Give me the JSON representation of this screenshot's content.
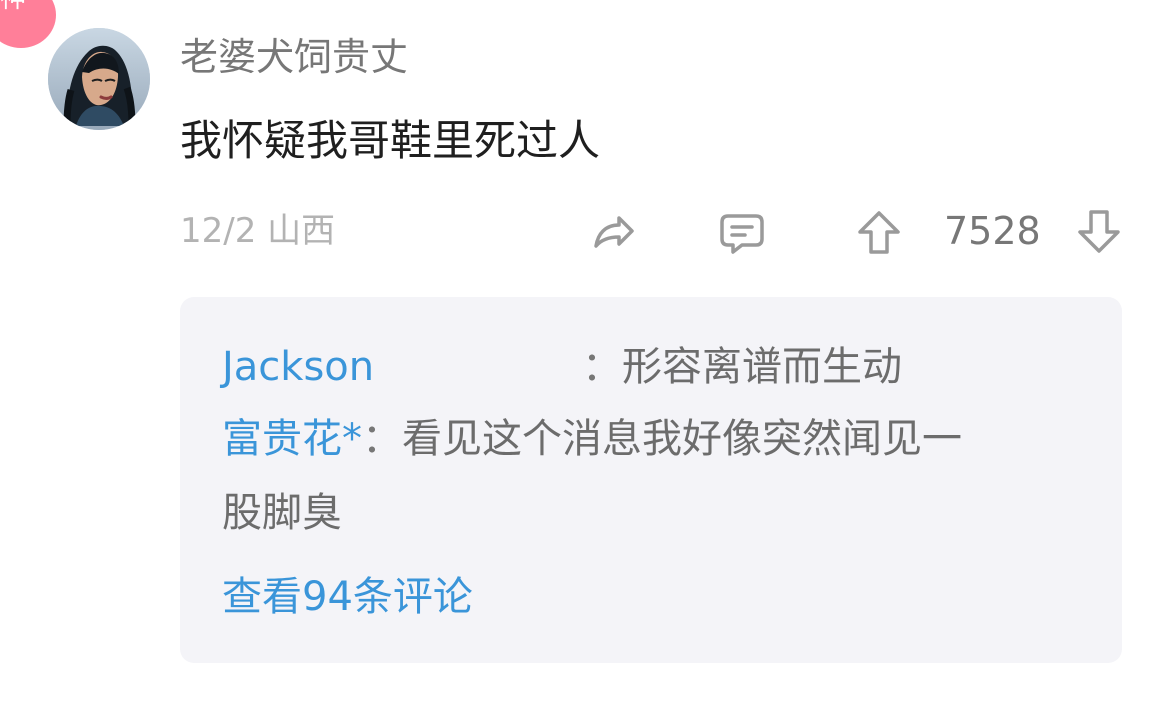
{
  "badge": {
    "label": "神"
  },
  "comment": {
    "username": "老婆犬饲贵丈",
    "text": "我怀疑我哥鞋里死过人",
    "date_location": "12/2 山西",
    "vote_count": "7528"
  },
  "icons": {
    "share": "share-icon",
    "reply": "comment-icon",
    "upvote": "arrow-up-icon",
    "downvote": "arrow-down-icon"
  },
  "replies": {
    "items": [
      {
        "author": "Jackson",
        "separator": "：",
        "body": "形容离谱而生动"
      },
      {
        "author": "富贵花*",
        "separator": "：",
        "body_line1": "看见这个消息我好像突然闻见一",
        "body_line2": "股脚臭"
      }
    ],
    "view_more": "查看94条评论"
  },
  "colors": {
    "badge_pink": "#ff7f99",
    "link_blue": "#3a95d9",
    "reply_panel_bg": "#f4f4f8"
  }
}
